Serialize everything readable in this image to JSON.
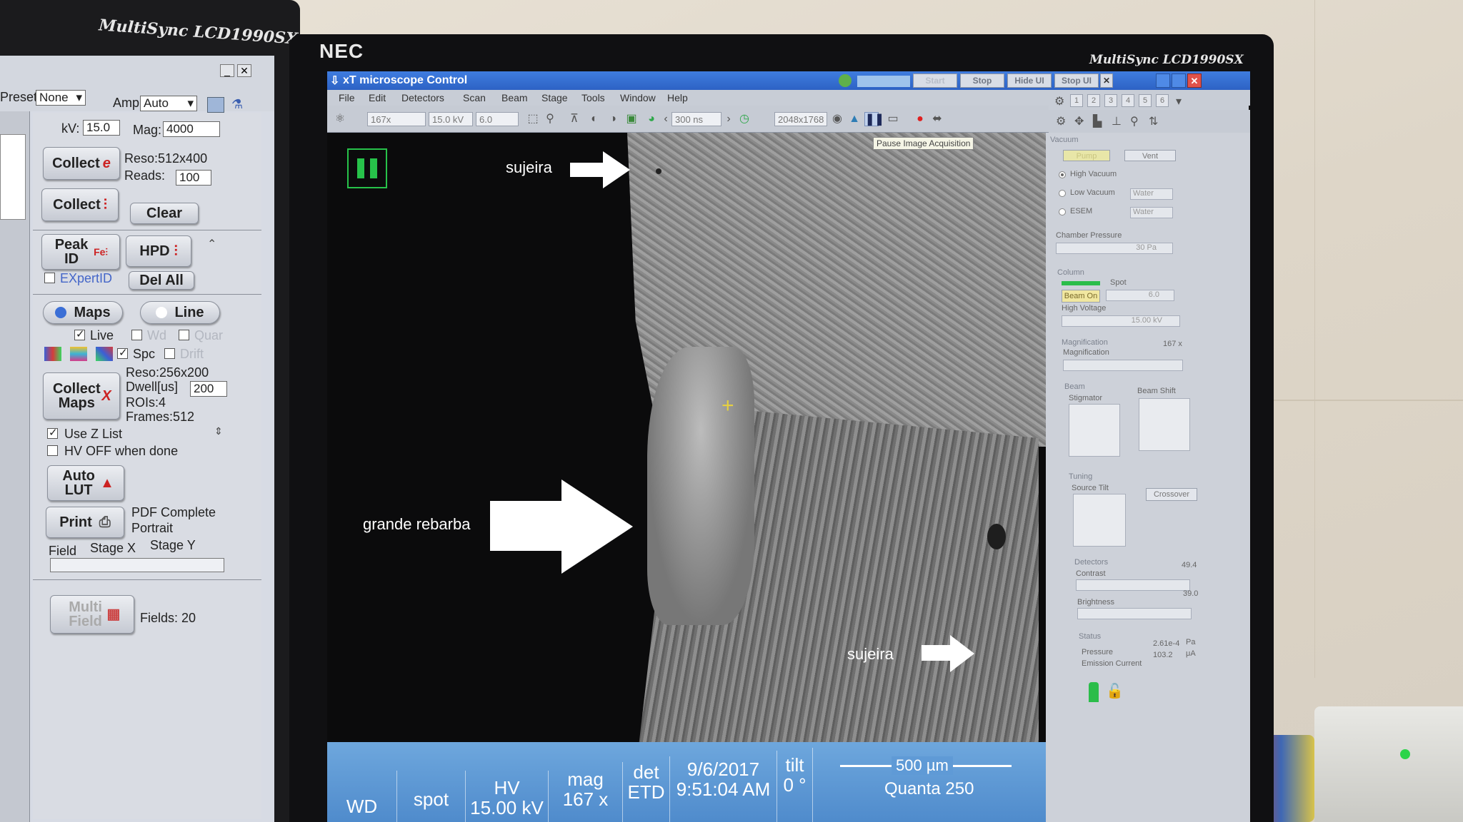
{
  "left_monitor": {
    "brand": "MultiSync LCD1990SX",
    "preset_label": "Preset",
    "preset_value": "None",
    "amp_label": "Amp",
    "amp_value": "Auto",
    "kv_label": "kV:",
    "kv_value": "15.0",
    "mag_label": "Mag:",
    "mag_value": "4000",
    "collect_e_label": "Collect",
    "reso_text": "Reso:512x400",
    "reads_label": "Reads:",
    "reads_value": "100",
    "collect_spectrum_label": "Collect",
    "clear_label": "Clear",
    "peak_id_label": "Peak ID",
    "hpd_label": "HPD",
    "expertid_label": "EXpertID",
    "del_all_label": "Del All",
    "maps_label": "Maps",
    "line_label": "Line",
    "live_label": "Live",
    "wd_label": "Wd",
    "quan_label": "Quar",
    "spc_label": "Spc",
    "drift_label": "Drift",
    "collect_maps_label": "Collect Maps",
    "maps_reso": "Reso:256x200",
    "dwell_label": "Dwell[us]",
    "dwell_value": "200",
    "rois_text": "ROIs:4",
    "frames_text": "Frames:512",
    "use_z_list_label": "Use Z List",
    "hv_off_label": "HV OFF when done",
    "auto_lut_label": "Auto LUT",
    "print_label": "Print",
    "print_desc_1": "PDF Complete",
    "print_desc_2": "Portrait",
    "field_label": "Field",
    "stage_x_label": "Stage X",
    "stage_y_label": "Stage Y",
    "multi_field_label": "Multi Field",
    "fields_text": "Fields: 20"
  },
  "nec_monitor": {
    "brand_logo": "NEC",
    "model": "MultiSync LCD1990SX"
  },
  "app": {
    "title": "xT microscope Control",
    "title_buttons": [
      "Start",
      "Stop",
      "Hide UI",
      "Stop UI"
    ],
    "quad_buttons": [
      "1",
      "2",
      "3",
      "4",
      "5",
      "6"
    ],
    "menu": [
      "File",
      "Edit",
      "Detectors",
      "Scan",
      "Beam",
      "Stage",
      "Tools",
      "Window",
      "Help"
    ],
    "toolbar": {
      "magnification": "167x",
      "high_voltage": "15.0 kV",
      "spot": "6.0",
      "dwell": "300 ns",
      "resolution": "2048x1768",
      "tooltip": "Pause Image Acquisition"
    },
    "panel": {
      "vacuum_title": "Vacuum",
      "pump_button": "Pump",
      "vent_button": "Vent",
      "high_vacuum": "High Vacuum",
      "low_vacuum": "Low Vacuum",
      "esem": "ESEM",
      "gas_1": "Water",
      "gas_2": "Water",
      "chamber_pressure_label": "Chamber Pressure",
      "chamber_pressure_value": "30 Pa",
      "column_title": "Column",
      "spot_label": "Spot",
      "beam_on_button": "Beam On",
      "spot_value": "6.0",
      "high_voltage_label": "High Voltage",
      "high_voltage_value": "15.00 kV",
      "magnification_title": "Magnification",
      "magnification_label": "Magnification",
      "magnification_value": "167 x",
      "beam_title": "Beam",
      "stigmator_label": "Stigmator",
      "beam_shift_label": "Beam Shift",
      "tuning_title": "Tuning",
      "source_tilt_label": "Source Tilt",
      "crossover_button": "Crossover",
      "detectors_title": "Detectors",
      "contrast_label": "Contrast",
      "contrast_value": "49.4",
      "brightness_label": "Brightness",
      "brightness_value": "39.0",
      "status_title": "Status",
      "pressure_label": "Pressure",
      "pressure_value": "2.61e-4",
      "pressure_unit": "Pa",
      "emission_label": "Emission Current",
      "emission_value": "103.2",
      "emission_unit": "μA"
    },
    "annotations": {
      "top": "sujeira",
      "middle": "grande rebarba",
      "bottom": "sujeira"
    },
    "status_bar": {
      "wd_label": "WD",
      "spot_label": "spot",
      "hv_label": "HV",
      "hv_value": "15.00 kV",
      "mag_label": "mag",
      "mag_value": "167 x",
      "det_label": "det",
      "det_value": "ETD",
      "date": "9/6/2017",
      "time": "9:51:04 AM",
      "tilt_label": "tilt",
      "tilt_value": "0 °",
      "scale_bar": "500 µm",
      "instrument": "Quanta 250"
    }
  }
}
